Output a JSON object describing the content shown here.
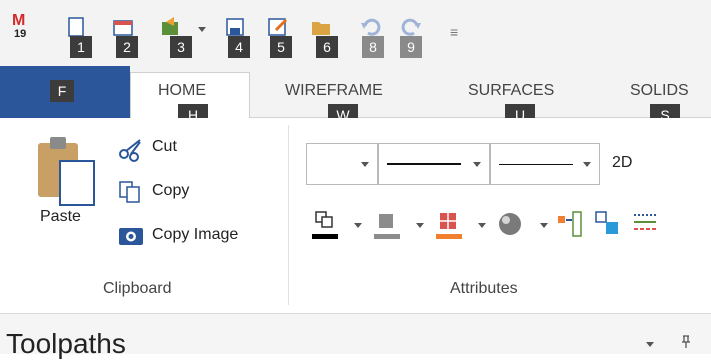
{
  "qat": {
    "keytips": [
      "1",
      "2",
      "3",
      "4",
      "5",
      "6",
      "8",
      "9"
    ]
  },
  "tabs": [
    {
      "label": "F",
      "key": "F"
    },
    {
      "label": "HOME",
      "key": "H"
    },
    {
      "label": "WIREFRAME",
      "key": "W"
    },
    {
      "label": "SURFACES",
      "key": "U"
    },
    {
      "label": "SOLIDS",
      "key": "S"
    }
  ],
  "clipboard": {
    "paste": "Paste",
    "cut": "Cut",
    "copy": "Copy",
    "copy_image": "Copy Image",
    "group": "Clipboard"
  },
  "attributes": {
    "mode": "2D",
    "group": "Attributes"
  },
  "panel": {
    "title": "Toolpaths"
  },
  "colors": {
    "file_tab": "#2b579a",
    "keytip": "#3c3c3c",
    "keytip_disabled": "#8a8a8a",
    "accent_orange": "#f08030",
    "icon_blue": "#2b579a"
  }
}
